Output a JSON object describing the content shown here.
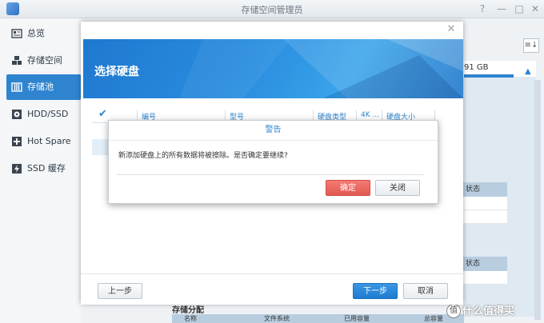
{
  "window": {
    "title": "存储空间管理员"
  },
  "sidebar": {
    "items": [
      {
        "label": "总览",
        "icon": "overview-icon"
      },
      {
        "label": "存储空间",
        "icon": "storage-icon"
      },
      {
        "label": "存储池",
        "icon": "storage-pool-icon",
        "active": true
      },
      {
        "label": "HDD/SSD",
        "icon": "disk-icon"
      },
      {
        "label": "Hot Spare",
        "icon": "hot-spare-icon"
      },
      {
        "label": "SSD 缓存",
        "icon": "ssd-cache-icon"
      }
    ]
  },
  "background": {
    "capacity_text": "91 GB",
    "status_header_1": "状态",
    "status_header_2": "状态",
    "section_title": "存储分配",
    "columns": [
      "名称",
      "文件系统",
      "已用容量",
      "总容量"
    ],
    "watermark": "值 什么值得买"
  },
  "dialog": {
    "title": "选择硬盘",
    "columns": [
      "编号",
      "型号",
      "硬盘类型",
      "4K ...",
      "硬盘大小"
    ],
    "back_label": "上一步",
    "next_label": "下一步",
    "cancel_label": "取消"
  },
  "alert": {
    "title": "警告",
    "message": "新添加硬盘上的所有数据将被擦除。是否确定要继续?",
    "confirm_label": "确定",
    "close_label": "关闭"
  },
  "colors": {
    "accent": "#2f84d0",
    "danger": "#e25a52"
  }
}
